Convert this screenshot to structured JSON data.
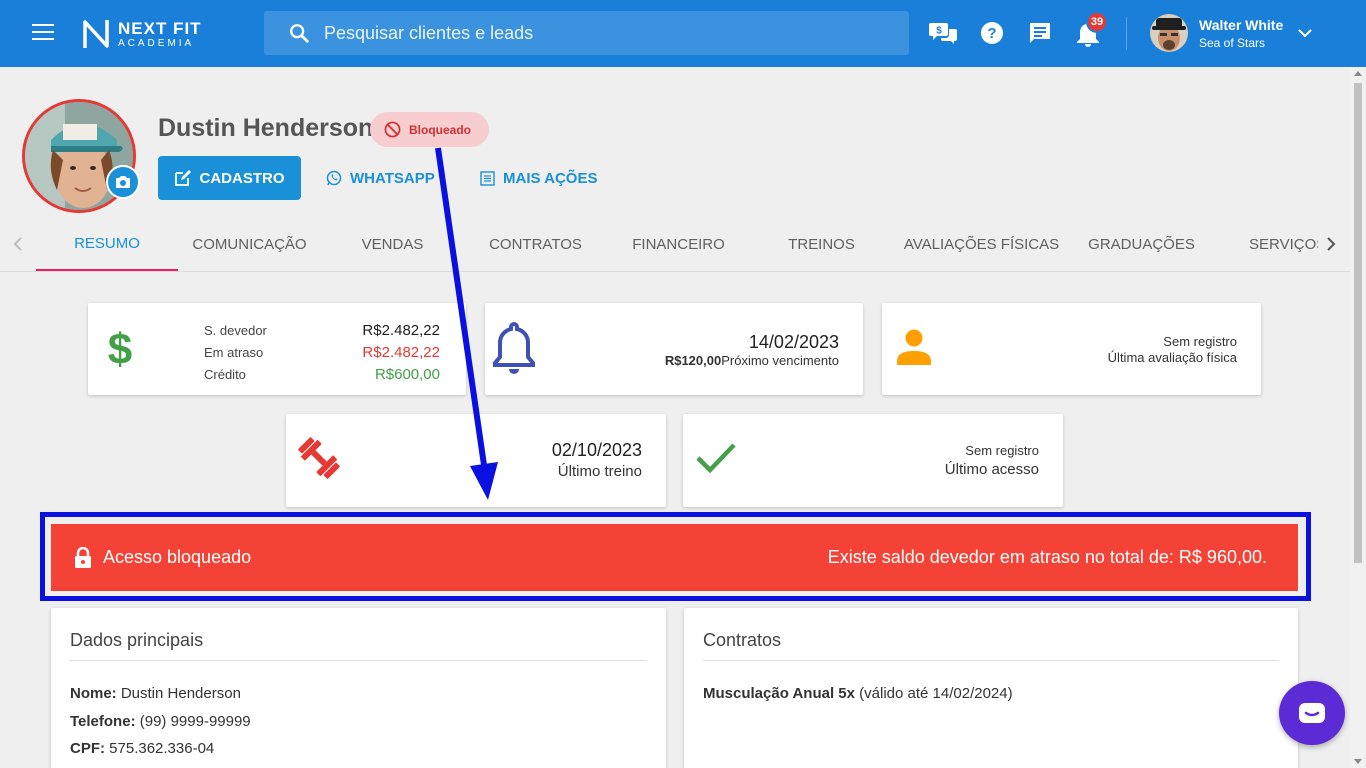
{
  "header": {
    "logo_line1": "NEXT FIT",
    "logo_line2": "ACADEMIA",
    "search_placeholder": "Pesquisar clientes e leads",
    "notification_count": "39",
    "user_name": "Walter White",
    "user_subtitle": "Sea of Stars",
    "icons": [
      "menu-icon",
      "chat-money-icon",
      "help-icon",
      "message-icon",
      "bell-icon",
      "chevron-down-icon"
    ]
  },
  "profile": {
    "name": "Dustin Henderson",
    "status_badge": "Bloqueado",
    "actions": {
      "cadastro": "CADASTRO",
      "whatsapp": "WHATSAPP",
      "mais_acoes": "MAIS AÇÕES"
    }
  },
  "tabs": [
    {
      "label": "RESUMO",
      "active": true
    },
    {
      "label": "COMUNICAÇÃO",
      "active": false
    },
    {
      "label": "VENDAS",
      "active": false
    },
    {
      "label": "CONTRATOS",
      "active": false
    },
    {
      "label": "FINANCEIRO",
      "active": false
    },
    {
      "label": "TREINOS",
      "active": false
    },
    {
      "label": "AVALIAÇÕES FÍSICAS",
      "active": false
    },
    {
      "label": "GRADUAÇÕES",
      "active": false
    },
    {
      "label": "SERVIÇOS",
      "active": false
    }
  ],
  "summary": {
    "finance": {
      "rows": [
        {
          "label": "S. devedor",
          "value": "R$2.482,22",
          "color": "#222222"
        },
        {
          "label": "Em atraso",
          "value": "R$2.482,22",
          "color": "#e53935"
        },
        {
          "label": "Crédito",
          "value": "R$600,00",
          "color": "#43a047"
        }
      ]
    },
    "next_due": {
      "date": "14/02/2023",
      "amount": "R$120,00",
      "label": "Próximo vencimento"
    },
    "evaluation": {
      "value": "Sem registro",
      "label": "Última avaliação física"
    },
    "last_training": {
      "date": "02/10/2023",
      "label": "Último treino"
    },
    "last_access": {
      "value": "Sem registro",
      "label": "Último acesso"
    }
  },
  "blocked_banner": {
    "title": "Acesso bloqueado",
    "message": "Existe saldo devedor em atraso no total de: R$ 960,00."
  },
  "dados_principais": {
    "title": "Dados principais",
    "fields": [
      {
        "label": "Nome:",
        "value": "Dustin Henderson"
      },
      {
        "label": "Telefone:",
        "value": "(99) 9999-99999"
      },
      {
        "label": "CPF:",
        "value": "575.362.336-04"
      }
    ]
  },
  "contratos": {
    "title": "Contratos",
    "items": [
      {
        "name": "Musculação Anual 5x",
        "detail": "(válido até 14/02/2024)"
      }
    ]
  },
  "colors": {
    "primary": "#1a7fd9",
    "accent_blue": "#1a90d8",
    "danger": "#f44336",
    "tab_indicator": "#e91e63",
    "annotation_blue": "#0a10e0",
    "chat_fab": "#5c2bd6"
  }
}
